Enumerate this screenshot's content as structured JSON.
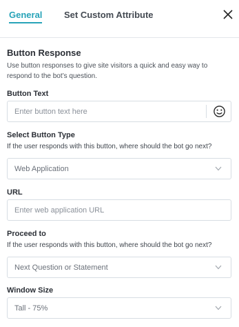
{
  "tabs": {
    "general": "General",
    "custom": "Set Custom Attribute"
  },
  "section": {
    "title": "Button Response",
    "description": "Use button responses to give site visitors a quick and easy way to respond to the bot’s question."
  },
  "button_text": {
    "label": "Button Text",
    "placeholder": "Enter button text here",
    "icon": "smiley-icon"
  },
  "button_type": {
    "label": "Select Button Type",
    "help": "If the user responds with this button, where should the bot go next?",
    "selected": "Web Application"
  },
  "url": {
    "label": "URL",
    "placeholder": "Enter web application URL"
  },
  "proceed_to": {
    "label": "Proceed to",
    "help": "If the user responds with this button, where should the bot go next?",
    "selected": "Next Question or Statement"
  },
  "window_size": {
    "label": "Window Size",
    "selected": "Tall - 75%"
  },
  "colors": {
    "accent": "#27a3b8",
    "border": "#d7dde3",
    "text": "#2b2f36"
  }
}
